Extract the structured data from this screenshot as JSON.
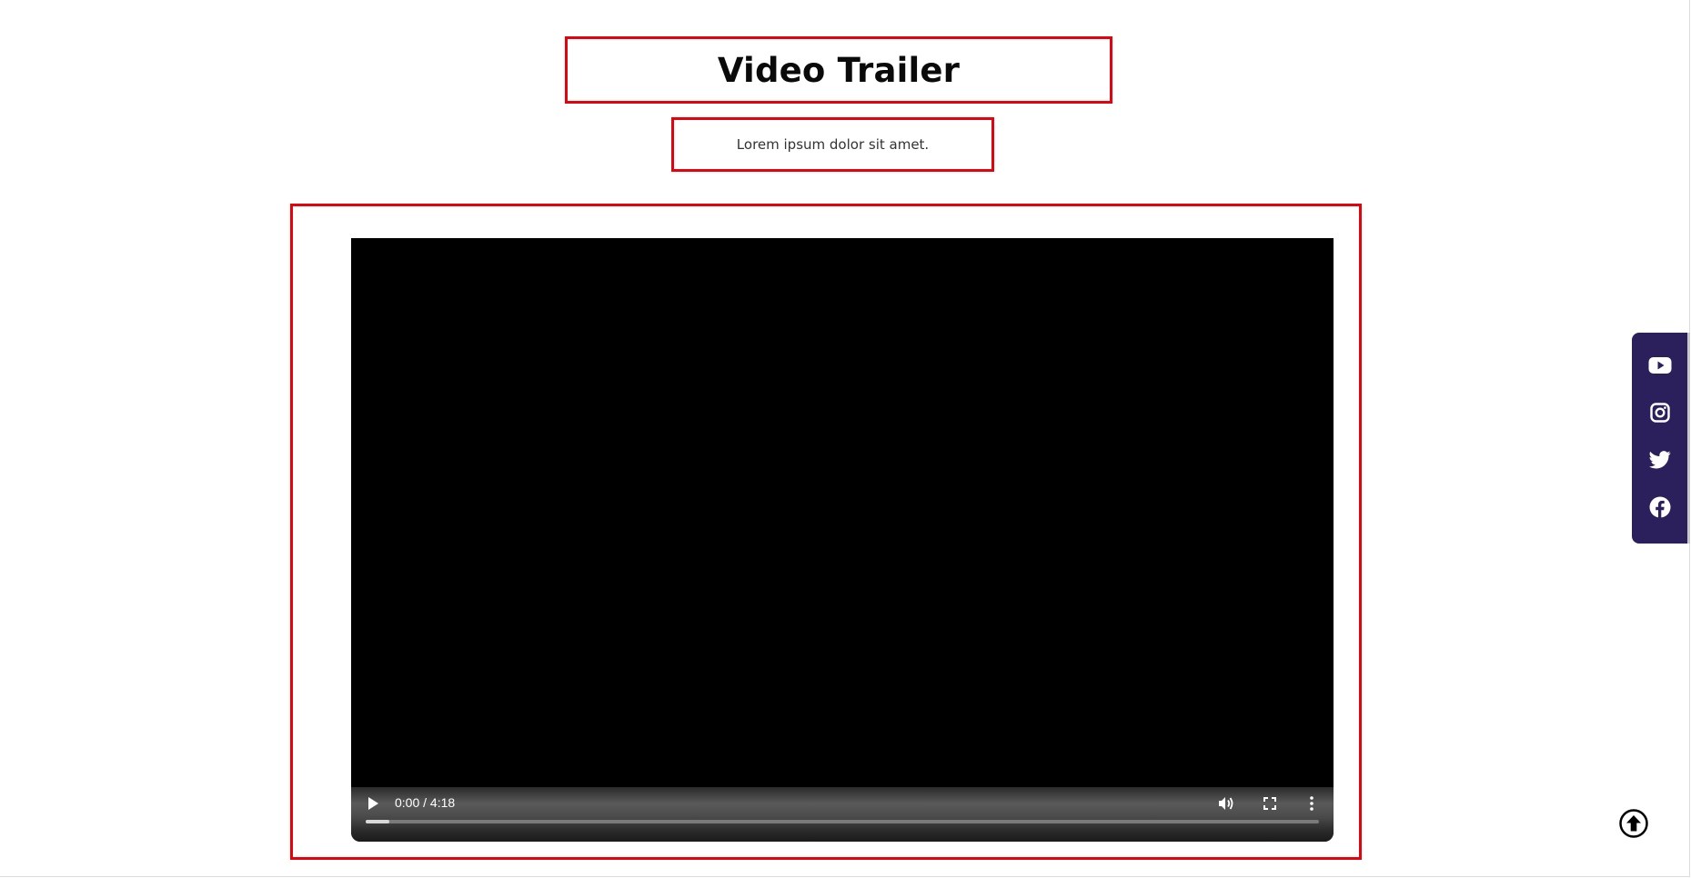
{
  "header": {
    "title": "Video Trailer",
    "subtitle": "Lorem ipsum dolor sit amet."
  },
  "video": {
    "current_time": "0:00",
    "duration": "4:18",
    "time_display": "0:00 / 4:18",
    "buffered_fraction": 0.025,
    "controls": {
      "play_icon": "play-icon",
      "volume_icon": "volume-icon",
      "fullscreen_icon": "fullscreen-icon",
      "more_icon": "more-options-icon"
    }
  },
  "social": {
    "background_color": "#2b1f5c",
    "items": [
      {
        "name": "youtube",
        "icon": "youtube-icon"
      },
      {
        "name": "instagram",
        "icon": "instagram-icon"
      },
      {
        "name": "twitter",
        "icon": "twitter-icon"
      },
      {
        "name": "facebook",
        "icon": "facebook-icon"
      }
    ]
  },
  "back_to_top": {
    "icon": "arrow-up-circle-icon"
  },
  "colors": {
    "highlight_border": "#e8000b",
    "title": "#0a0a0a",
    "subtitle": "#333333",
    "video_bg": "#000000"
  }
}
